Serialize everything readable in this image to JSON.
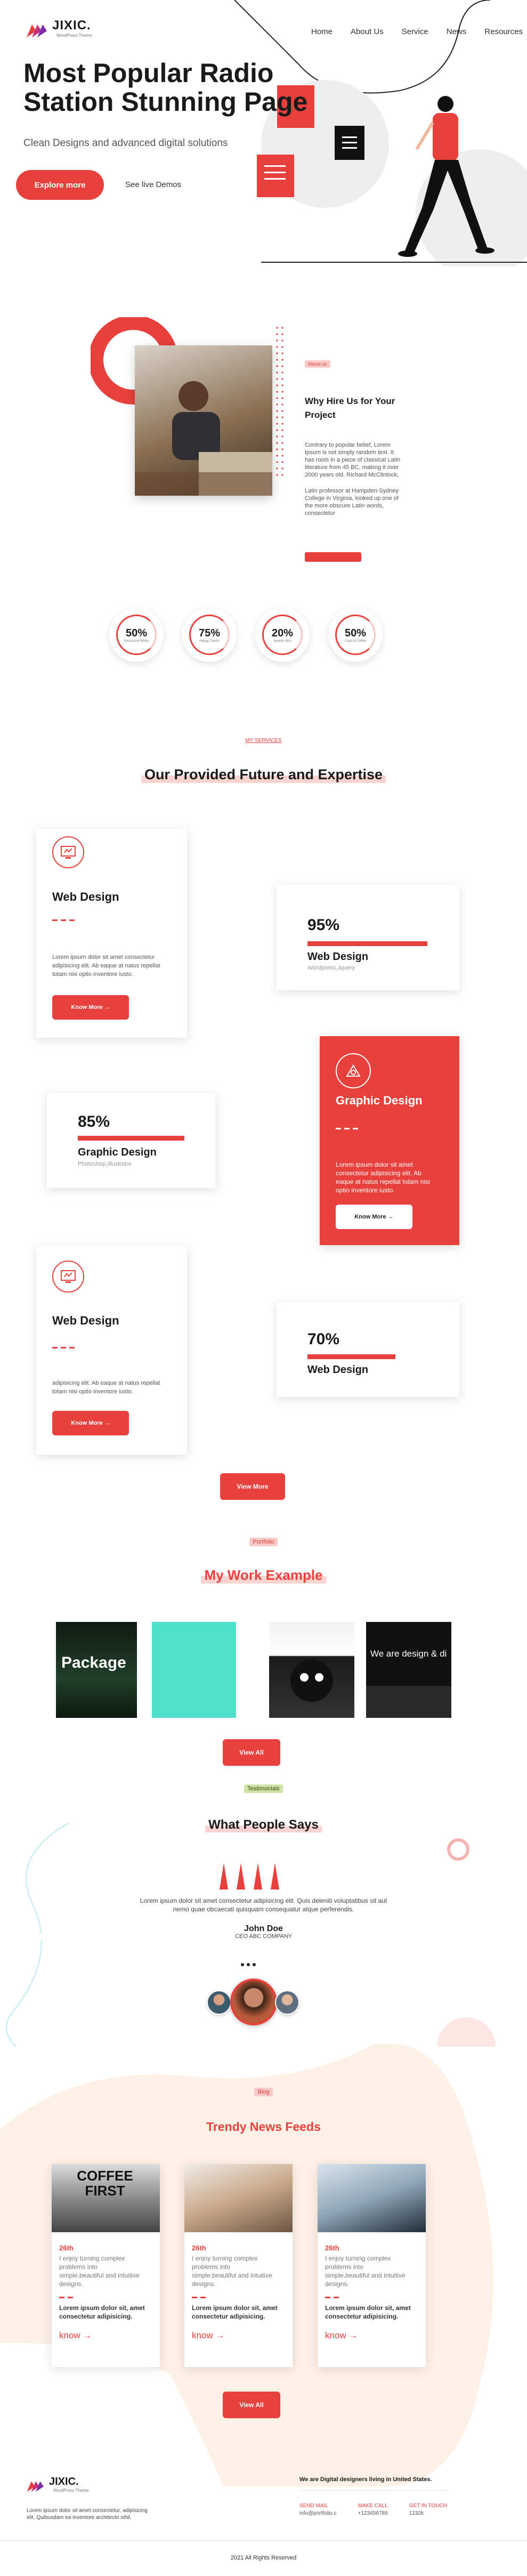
{
  "brand": {
    "logo": "JIXIC.",
    "tagline": "WordPress Theme"
  },
  "nav": [
    "Home",
    "About Us",
    "Service",
    "News",
    "Resources"
  ],
  "hero": {
    "title_line1": "Most Popular Radio",
    "title_line2": "Station Stunning Page",
    "subtitle": "Clean Designs and advanced digital solutions",
    "cta": "Explore more",
    "demo": "See live Demos"
  },
  "about": {
    "tag": "About us",
    "heading_line1": "Why Hire Us for Your",
    "heading_line2": "Project",
    "p1": [
      "Contrary to popular belief, Lorem",
      "Ipsum is not simply random text. It",
      "has roots in a piece of classical Latin",
      "literature from 45 BC, making it over",
      "2000 years old. Richard McClintock,"
    ],
    "p2": [
      "Latin professor at Hampden-Sydney",
      "College in Virginia, looked up one of",
      "the more obscure Latin words,",
      "consectetur"
    ]
  },
  "stats": [
    {
      "value": "50%",
      "label": "Successful Works"
    },
    {
      "value": "75%",
      "label": "Happy Clients"
    },
    {
      "value": "20%",
      "label": "Awards Won"
    },
    {
      "value": "50%",
      "label": "Cups of Coffee"
    }
  ],
  "services": {
    "tag": "MY SERVICES",
    "title": "Our Provided Future and Expertise",
    "cards": [
      {
        "title": "Web Design",
        "text": [
          "Lorem ipsum dolor sit amet consectetur",
          "adipisicing elit. Ab eaque at natus repellat",
          "totam nisi optio inventore iusto."
        ],
        "btn": "Know More →"
      },
      {
        "title": "Graphic Design",
        "text": [
          "Lorem ipsum dolor sit amet",
          "consectetur adipisicing elit. Ab",
          "eaque at natus repellat totam nisi",
          "optio inventore iusto."
        ],
        "btn": "Know More →"
      },
      {
        "title": "Web Design",
        "text": [
          "adipisicing elit. Ab eaque at natus repellat",
          "totam nisi optio inventore iusto."
        ],
        "btn": "Know More →"
      }
    ],
    "skills": [
      {
        "value": "95%",
        "title": "Web Design",
        "sub": "Wordpress,Jquery",
        "fill": 0.95
      },
      {
        "value": "85%",
        "title": "Graphic Design",
        "sub": "Photoshop,Illustrator",
        "fill": 0.85
      },
      {
        "value": "70%",
        "title": "Web Design",
        "sub": "",
        "fill": 0.7
      }
    ],
    "view_more": "View More"
  },
  "portfolio": {
    "tag": "Portfolio",
    "title": "My Work Example",
    "items": [
      "Package",
      "",
      "",
      "We are design & di"
    ],
    "view_all": "View All"
  },
  "testimonials": {
    "tag": "Testimonials",
    "title": "What People Says",
    "quote_line1": "Lorem ipsum dolor sit amet consectetur adipisicing elit. Quis deleniti voluptatibus sit aut",
    "quote_line2": "nemo quae obcaecati quisquam consequatur atque perferendis.",
    "name": "John Doe",
    "company": "CEO ABC COMPANY"
  },
  "blog": {
    "tag": "Blog",
    "title": "Trendy News Feeds",
    "cards": [
      {
        "img_text": "COFFEE FIRST",
        "date": "26th",
        "desc": [
          "I enjoy turning complex",
          "problems into",
          "simple,beautiful and intuitive",
          "designs."
        ],
        "bold": [
          "Lorem ipsum dolor sit, amet",
          "consectetur adipisicing."
        ],
        "more": "know →"
      },
      {
        "img_text": "",
        "date": "26th",
        "desc": [
          "I enjoy turning complex",
          "problems into",
          "simple,beautiful and intuitive",
          "designs."
        ],
        "bold": [
          "Lorem ipsum dolor sit, amet",
          "consectetur adipisicing."
        ],
        "more": "know →"
      },
      {
        "img_text": "",
        "date": "26th",
        "desc": [
          "I enjoy turning complex",
          "problems into",
          "simple,beautiful and intuitive",
          "designs."
        ],
        "bold": [
          "Lorem ipsum dolor sit, amet",
          "consectetur adipisicing."
        ],
        "more": "know →"
      }
    ],
    "view_all": "View All"
  },
  "footer": {
    "logo": "JIXIC.",
    "tagline": "WordPress Theme",
    "about_line1": "Lorem ipsum dolor sit amet consectetur, adipisicing",
    "about_line2": "elit. Quibusdam ea inventore architecto nihil.",
    "heading": "We are Digital designers living in United States.",
    "contacts": [
      {
        "label": "SEND MAIL",
        "value": "info@portfolio.c"
      },
      {
        "label": "MAKE CALL",
        "value": "+123456789"
      },
      {
        "label": "GET IN TOUCH",
        "value": "1232k"
      }
    ],
    "copyright": "2021 All Rights Reserved"
  },
  "colors": {
    "accent": "#e8413d",
    "teal": "#4fe0cc"
  }
}
